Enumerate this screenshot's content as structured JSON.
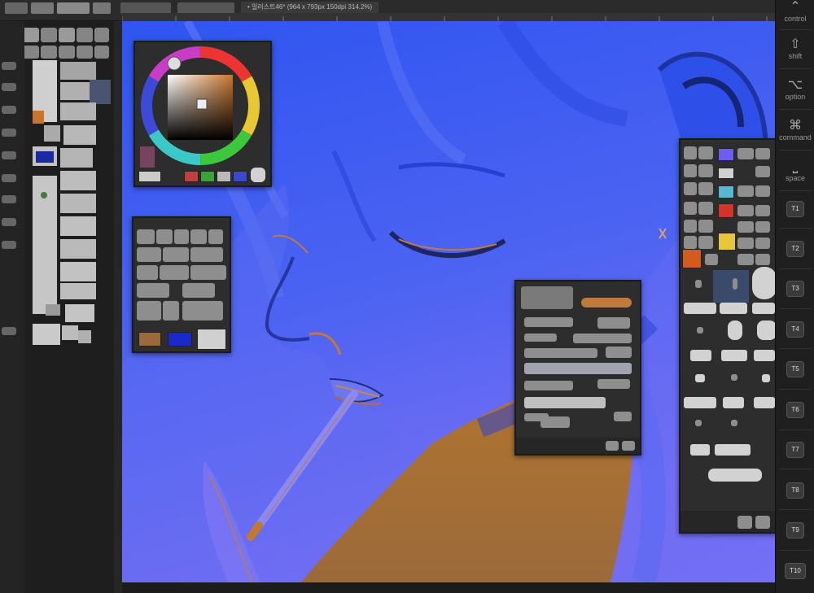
{
  "document": {
    "tab_title": "• 일러스트46* (964 x 793px 150dpi 314.2%)"
  },
  "keyboard": {
    "control": {
      "label": "control",
      "icon": "chevron-up-icon"
    },
    "shift": {
      "label": "shift",
      "icon": "shift-arrow-icon"
    },
    "option": {
      "label": "option",
      "icon": "option-key-icon"
    },
    "command": {
      "label": "command",
      "icon": "command-key-icon"
    },
    "space": {
      "label": "space",
      "icon": "space-bar-icon"
    },
    "tkeys": [
      "T1",
      "T2",
      "T3",
      "T4",
      "T5",
      "T6",
      "T7",
      "T8",
      "T9",
      "T10"
    ]
  },
  "colors": {
    "canvas_blue": "#3a5ef2",
    "canvas_violet": "#7a6df5",
    "skin_orange": "#c07a2c",
    "shadow_dark": "#1f2d72",
    "app_dark": "#262626",
    "swatch_purple": "#6f5df2",
    "swatch_teal": "#56b7d2",
    "swatch_red": "#d2342a",
    "swatch_yellow": "#e7c639",
    "swatch_orange": "#d45a1e",
    "swatch_navy": "#3a4a6a",
    "swatch_blue": "#1a2ac8",
    "swatch_brown": "#9a6a3a"
  },
  "color_wheel": {
    "current_color": "#c87a3a"
  }
}
